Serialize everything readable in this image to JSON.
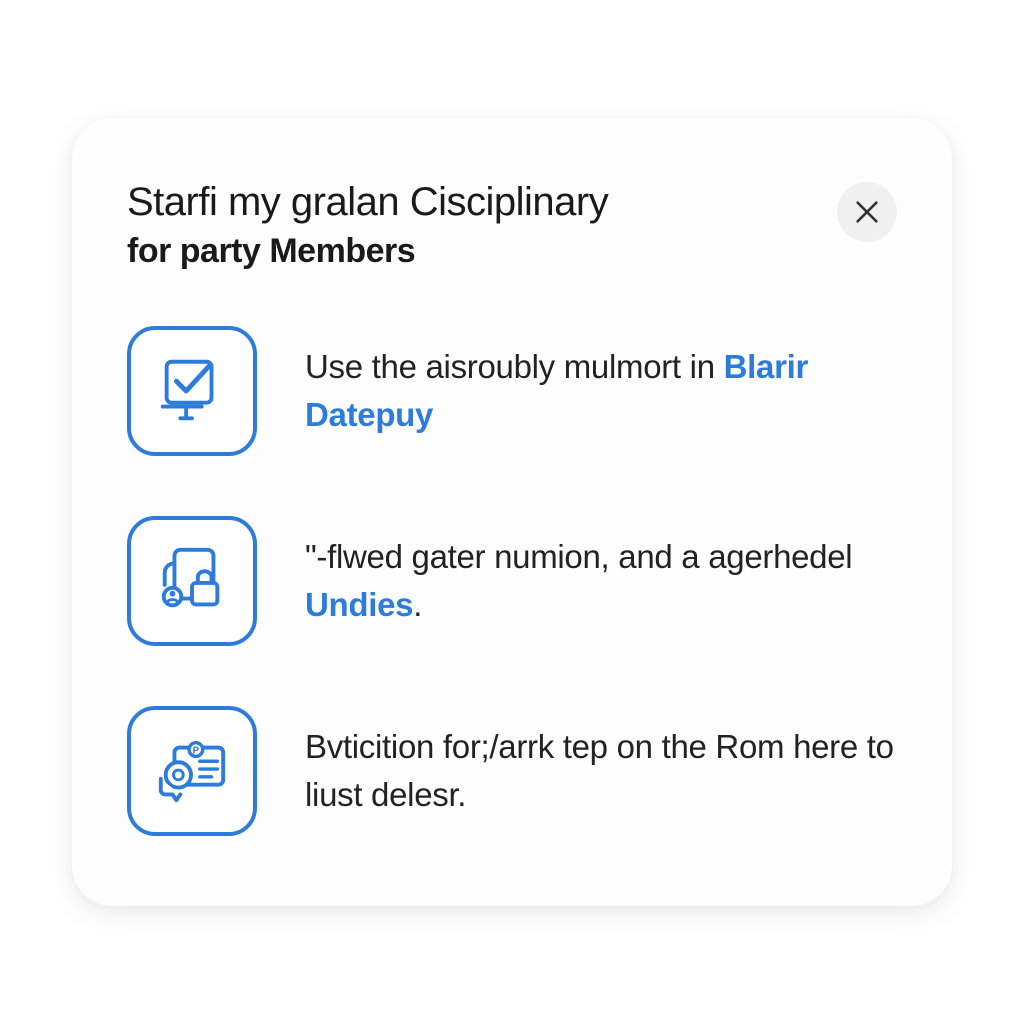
{
  "header": {
    "title": "Starfi my gralan Cisciplinary",
    "subtitle": "for party Members"
  },
  "items": [
    {
      "icon": "checklist-icon",
      "text_prefix": "Use the aisroubly mulmort in ",
      "link": "Blarir Datepuy",
      "text_suffix": ""
    },
    {
      "icon": "lock-document-icon",
      "text_prefix": "\"-flwed gater numion, and a agerhedel ",
      "link": "Undies",
      "text_suffix": "."
    },
    {
      "icon": "card-chat-icon",
      "text_prefix": "Bvticition for;/arrk tep on the Rom here to liust delesr.",
      "link": "",
      "text_suffix": ""
    }
  ],
  "colors": {
    "primary_blue": "#2d7cdb",
    "text_dark": "#1a1a1a"
  }
}
